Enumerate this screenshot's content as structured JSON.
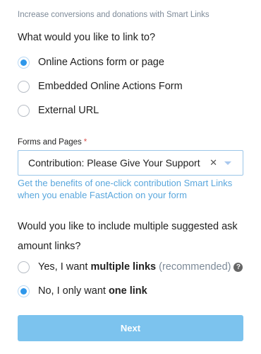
{
  "subtitle": "Increase conversions and donations with Smart Links",
  "link_question": "What would you like to link to?",
  "link_options": [
    {
      "label": "Online Actions form or page",
      "checked": true
    },
    {
      "label": "Embedded Online Actions Form",
      "checked": false
    },
    {
      "label": "External URL",
      "checked": false
    }
  ],
  "forms_field": {
    "label": "Forms and Pages",
    "required_mark": "*",
    "value": "Contribution: Please Give Your Support",
    "clear_glyph": "✕"
  },
  "hint": "Get the benefits of one-click contribution Smart Links when you enable FastAction on your form",
  "ask_question": "Would you like to include multiple suggested ask amount links?",
  "ask_options": [
    {
      "prefix": "Yes, I want ",
      "bold": "multiple links",
      "suffix": " (recommended)",
      "help_glyph": "?",
      "checked": false
    },
    {
      "prefix": "No, I only want ",
      "bold": "one link",
      "checked": true
    }
  ],
  "next_label": "Next",
  "colors": {
    "accent": "#2e97ea",
    "button": "#7cc3ee",
    "hint": "#5aa7dd",
    "muted": "#7d8a98"
  }
}
